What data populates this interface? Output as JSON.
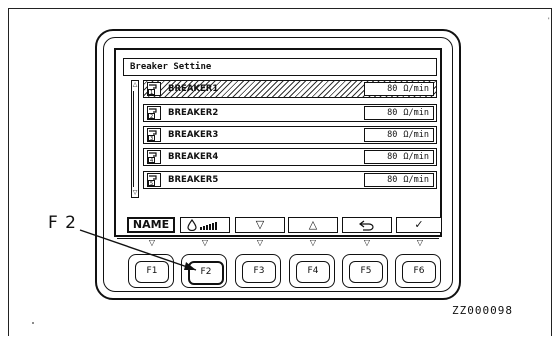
{
  "screen": {
    "title": "Breaker Settine",
    "scroll_up": "△",
    "scroll_down": "▽",
    "rows": [
      {
        "index": "1",
        "name": "BREAKER1",
        "value": "80",
        "unit": "Ω/min",
        "selected": true
      },
      {
        "index": "2",
        "name": "BREAKER2",
        "value": "80",
        "unit": "Ω/min",
        "selected": false
      },
      {
        "index": "3",
        "name": "BREAKER3",
        "value": "80",
        "unit": "Ω/min",
        "selected": false
      },
      {
        "index": "4",
        "name": "BREAKER4",
        "value": "80",
        "unit": "Ω/min",
        "selected": false
      },
      {
        "index": "5",
        "name": "BREAKER5",
        "value": "80",
        "unit": "Ω/min",
        "selected": false
      }
    ]
  },
  "softkeys": {
    "name_label": "NAME",
    "f2_icon": "flow-rate-icon",
    "f3_label": "▽",
    "f4_label": "△",
    "f5_icon": "return-icon",
    "f6_label": "✓"
  },
  "indicators": [
    "▽",
    "▽",
    "▽",
    "▽",
    "▽",
    "▽"
  ],
  "buttons": [
    "F1",
    "F2",
    "F3",
    "F4",
    "F5",
    "F6"
  ],
  "callout": {
    "label": "F 2"
  },
  "figure_code": "ZZ000098"
}
